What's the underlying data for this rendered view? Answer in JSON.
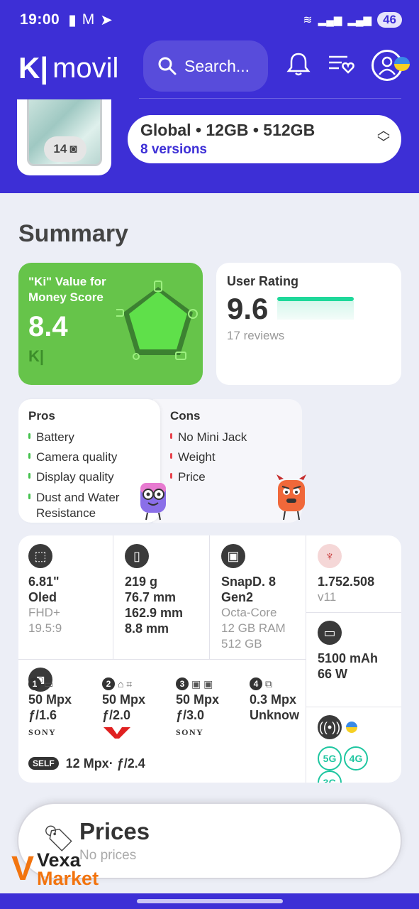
{
  "status_bar": {
    "time": "19:00",
    "battery": "46"
  },
  "header": {
    "logo_text": "movil",
    "search_placeholder": "Search..."
  },
  "device": {
    "photo_count": "14",
    "variant": "Global • 12GB • 512GB",
    "versions": "8 versions"
  },
  "summary": {
    "title": "Summary",
    "ki_score": {
      "label": "\"Ki\" Value for Money Score",
      "value": "8.4",
      "color": "#66c44a"
    },
    "user_rating": {
      "label": "User Rating",
      "value": "9.6",
      "reviews": "17 reviews",
      "bar_fill": 0.96
    }
  },
  "pros": {
    "title": "Pros",
    "items": [
      "Battery",
      "Camera quality",
      "Display quality",
      "Dust and Water Resistance"
    ]
  },
  "cons": {
    "title": "Cons",
    "items": [
      "No Mini Jack",
      "Weight",
      "Price"
    ]
  },
  "specs": {
    "display": {
      "size": "6.81\"",
      "type": "Oled",
      "res": "FHD+",
      "ratio": "19.5:9"
    },
    "body": {
      "weight": "219 g",
      "width": "76.7 mm",
      "height": "162.9 mm",
      "depth": "8.8 mm"
    },
    "chip": {
      "name": "SnapD. 8 Gen2",
      "cores": "Octa-Core",
      "ram": "12 GB RAM",
      "storage": "512 GB"
    },
    "antutu": {
      "score": "1.752.508",
      "version": "v11"
    },
    "battery": {
      "capacity": "5100 mAh",
      "charge": "66 W"
    },
    "cameras": [
      {
        "num": "1",
        "mp": "50 Mpx",
        "f": "ƒ/1.6",
        "brand": "SONY"
      },
      {
        "num": "2",
        "mp": "50 Mpx",
        "f": "ƒ/2.0",
        "brand": ""
      },
      {
        "num": "3",
        "mp": "50 Mpx",
        "f": "ƒ/3.0",
        "brand": "SONY"
      },
      {
        "num": "4",
        "mp": "0.3 Mpx",
        "f": "Unknow",
        "brand": ""
      }
    ],
    "selfie": {
      "badge": "SELF",
      "value": "12 Mpx· ƒ/2.4"
    },
    "network": [
      "5G",
      "4G",
      "3G"
    ]
  },
  "prices": {
    "title": "Prices",
    "subtitle": "No prices"
  },
  "watermark": {
    "line1": "Vexa",
    "line2": "Market"
  }
}
